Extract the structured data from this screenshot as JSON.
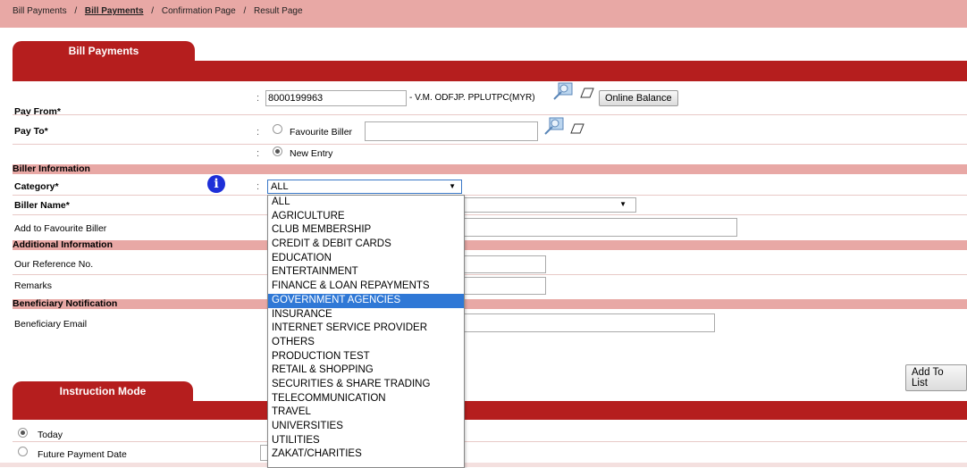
{
  "breadcrumb": {
    "items": [
      "Bill Payments",
      "Bill Payments",
      "Confirmation Page",
      "Result Page"
    ],
    "separator": "/"
  },
  "tabs": {
    "bill_payments": "Bill Payments",
    "instruction_mode": "Instruction Mode"
  },
  "form": {
    "pay_from_label": "Pay From*",
    "pay_from_account": "8000199963",
    "pay_from_name": "- V.M. ODFJP. PPLUTPC(MYR)",
    "online_balance": "Online Balance",
    "pay_to_label": "Pay To*",
    "favourite_biller": "Favourite Biller",
    "new_entry": "New Entry",
    "biller_info_header": "Biller Information",
    "category_label": "Category*",
    "category_value": "ALL",
    "biller_name_label": "Biller Name*",
    "add_fav_label": "Add to Favourite Biller",
    "additional_info_header": "Additional Information",
    "our_ref_label": "Our Reference No.",
    "remarks_label": "Remarks",
    "beneficiary_header": "Beneficiary Notification",
    "beneficiary_email_label": "Beneficiary Email",
    "add_to_list": "Add To List",
    "today": "Today",
    "future_date": "Future Payment Date",
    "colon": ":"
  },
  "category_options": [
    "ALL",
    "AGRICULTURE",
    "CLUB MEMBERSHIP",
    "CREDIT & DEBIT CARDS",
    "EDUCATION",
    "ENTERTAINMENT",
    "FINANCE & LOAN REPAYMENTS",
    "GOVERNMENT AGENCIES",
    "INSURANCE",
    "INTERNET SERVICE PROVIDER",
    "OTHERS",
    "PRODUCTION TEST",
    "RETAIL & SHOPPING",
    "SECURITIES & SHARE TRADING",
    "TELECOMMUNICATION",
    "TRAVEL",
    "UNIVERSITIES",
    "UTILITIES",
    "ZAKAT/CHARITIES"
  ],
  "highlighted_option": "GOVERNMENT AGENCIES",
  "info_icon": "i",
  "colors": {
    "accent": "#b51e1e",
    "section_bg": "#e8a8a5",
    "highlight": "#2f78d6",
    "info": "#1e2fd8"
  }
}
